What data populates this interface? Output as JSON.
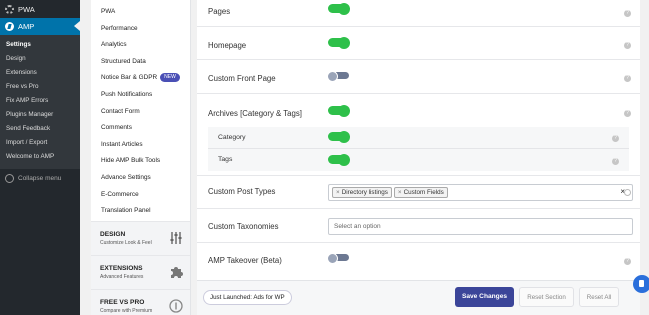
{
  "wp_menu": {
    "top_item": "PWA",
    "current_item": "AMP",
    "submenu": [
      "Settings",
      "Design",
      "Extensions",
      "Free vs Pro",
      "Fix AMP Errors",
      "Plugins Manager",
      "Send Feedback",
      "Import / Export",
      "Welcome to AMP"
    ],
    "collapse_label": "Collapse menu"
  },
  "plugin_nav": {
    "items": [
      {
        "label": "PWA"
      },
      {
        "label": "Performance"
      },
      {
        "label": "Analytics"
      },
      {
        "label": "Structured Data"
      },
      {
        "label": "Notice Bar & GDPR",
        "badge": "NEW"
      },
      {
        "label": "Push Notifications"
      },
      {
        "label": "Contact Form"
      },
      {
        "label": "Comments"
      },
      {
        "label": "Instant Articles"
      },
      {
        "label": "Hide AMP Bulk Tools"
      },
      {
        "label": "Advance Settings"
      },
      {
        "label": "E-Commerce"
      },
      {
        "label": "Translation Panel"
      }
    ],
    "blocks": [
      {
        "title": "DESIGN",
        "subtitle": "Customize Look & Feel",
        "icon": "sliders-icon"
      },
      {
        "title": "EXTENSIONS",
        "subtitle": "Advanced Features",
        "icon": "puzzle-icon"
      },
      {
        "title": "FREE VS PRO",
        "subtitle": "Compare with Premium",
        "icon": "dollar-icon"
      }
    ]
  },
  "settings": {
    "pages": {
      "label": "Pages",
      "enabled": true
    },
    "homepage": {
      "label": "Homepage",
      "enabled": true
    },
    "custom_front_page": {
      "label": "Custom Front Page",
      "enabled": false
    },
    "archives": {
      "label": "Archives [Category & Tags]",
      "enabled": true
    },
    "category": {
      "label": "Category",
      "enabled": true
    },
    "tags": {
      "label": "Tags",
      "enabled": true
    },
    "custom_post_types": {
      "label": "Custom Post Types",
      "selected": [
        "Directory listings",
        "Custom Fields"
      ],
      "remove_symbol": "×",
      "clear_symbol": "×"
    },
    "custom_taxonomies": {
      "label": "Custom Taxonomies",
      "placeholder": "Select an option"
    },
    "amp_takeover": {
      "label": "AMP Takeover (Beta)",
      "enabled": false
    },
    "help_symbol": "?"
  },
  "footer": {
    "launch_label": "Just Launched: Ads for WP",
    "save_label": "Save Changes",
    "reset_section_label": "Reset Section",
    "reset_all_label": "Reset All"
  },
  "colors": {
    "wp_sidebar": "#23282d",
    "wp_accent": "#0073aa",
    "toggle_on": "#2ec04a",
    "toggle_off": "#6c7892",
    "save_button": "#3b4599"
  }
}
